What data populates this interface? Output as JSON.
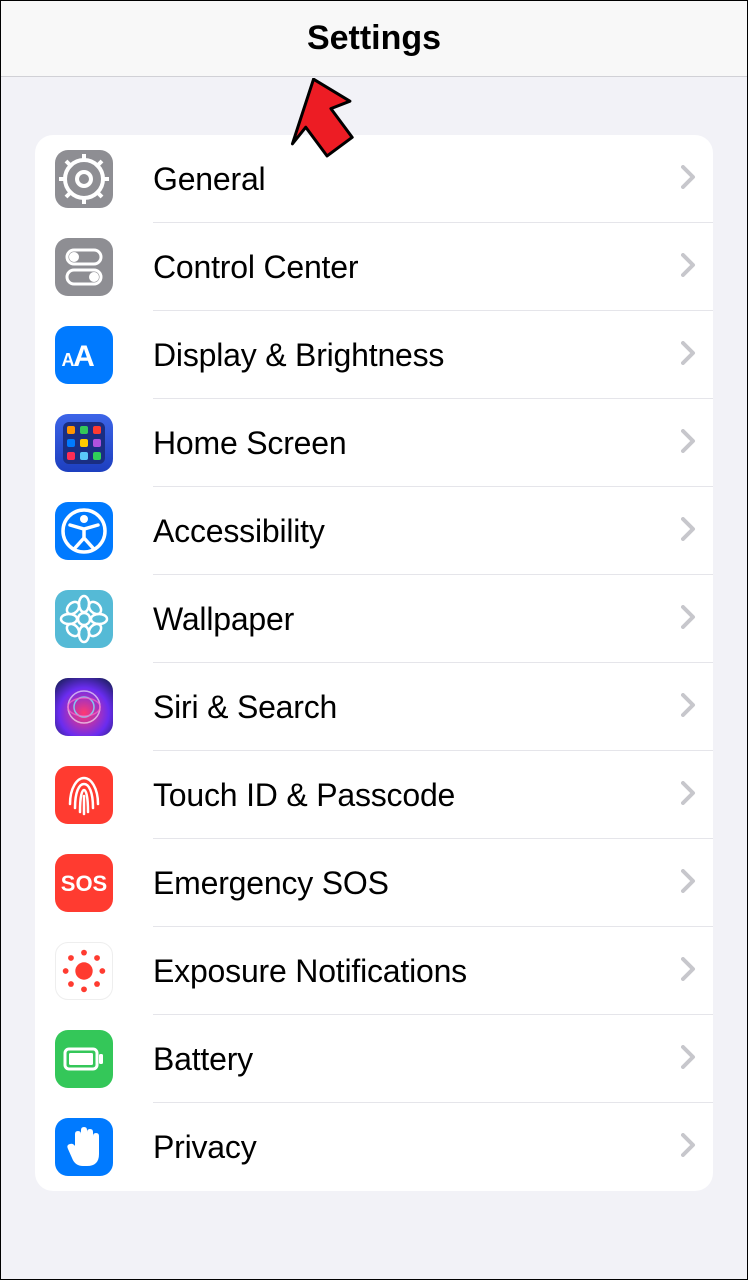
{
  "header": {
    "title": "Settings"
  },
  "rows": [
    {
      "id": "general",
      "label": "General",
      "icon": "gear-icon",
      "bgClass": "bg-gray"
    },
    {
      "id": "control-center",
      "label": "Control Center",
      "icon": "toggles-icon",
      "bgClass": "bg-gray2"
    },
    {
      "id": "display",
      "label": "Display & Brightness",
      "icon": "aa-icon",
      "bgClass": "bg-blue"
    },
    {
      "id": "home-screen",
      "label": "Home Screen",
      "icon": "apps-grid-icon",
      "bgClass": "bg-indigo"
    },
    {
      "id": "accessibility",
      "label": "Accessibility",
      "icon": "accessibility-icon",
      "bgClass": "bg-blue"
    },
    {
      "id": "wallpaper",
      "label": "Wallpaper",
      "icon": "flower-icon",
      "bgClass": "bg-teal"
    },
    {
      "id": "siri",
      "label": "Siri & Search",
      "icon": "siri-icon",
      "bgClass": "bg-siri"
    },
    {
      "id": "touchid",
      "label": "Touch ID & Passcode",
      "icon": "fingerprint-icon",
      "bgClass": "bg-red"
    },
    {
      "id": "emergency-sos",
      "label": "Emergency SOS",
      "icon": "sos-icon",
      "bgClass": "bg-red"
    },
    {
      "id": "exposure",
      "label": "Exposure Notifications",
      "icon": "exposure-icon",
      "bgClass": "bg-white"
    },
    {
      "id": "battery",
      "label": "Battery",
      "icon": "battery-icon",
      "bgClass": "bg-green"
    },
    {
      "id": "privacy",
      "label": "Privacy",
      "icon": "hand-icon",
      "bgClass": "bg-blue2"
    }
  ],
  "annotation": {
    "pointsTo": "general"
  },
  "colors": {
    "gray": "#8e8e93",
    "blue": "#007aff",
    "red": "#ff3b30",
    "green": "#34c759",
    "teal": "#55bad6",
    "indigo": "#3d65e8"
  }
}
